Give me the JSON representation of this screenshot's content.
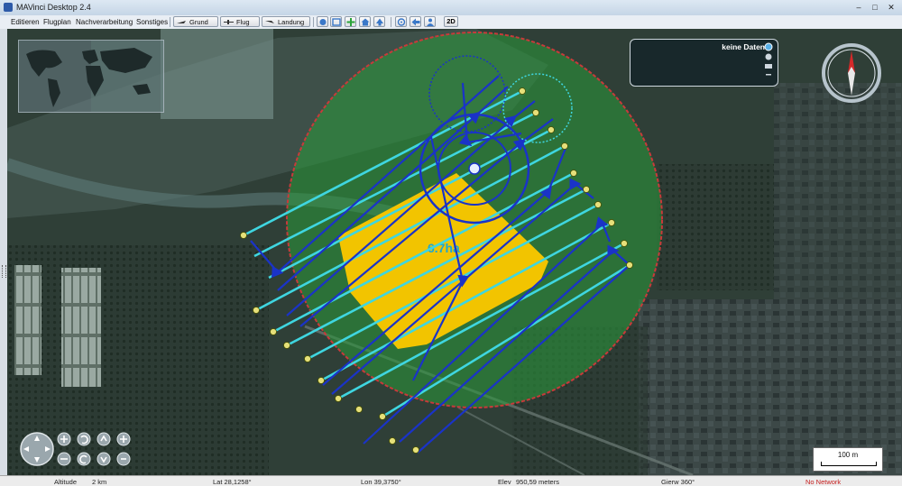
{
  "window": {
    "title": "MAVinci Desktop 2.4",
    "minimize": "–",
    "maximize": "□",
    "close": "✕"
  },
  "menu": {
    "items": [
      "Editieren",
      "Flugplan",
      "Nachverarbeitung",
      "Sonstiges"
    ]
  },
  "toolbar": {
    "buttons": [
      {
        "label": "Grund",
        "icon": "takeoff-icon"
      },
      {
        "label": "Flug",
        "icon": "plane-icon"
      },
      {
        "label": "Landung",
        "icon": "landing-icon"
      }
    ],
    "icons": [
      "select-icon",
      "measure-icon",
      "add-icon",
      "home-icon",
      "up-icon",
      "center-icon",
      "back-icon",
      "person-icon"
    ],
    "view_2d": "2D"
  },
  "overlay": {
    "legend_title": "keine Daten",
    "area_label": "6.7ha",
    "scale_label": "100 m"
  },
  "colors": {
    "flight_line": "#1a33c8",
    "image_line": "#3fd6e0",
    "area_fill": "#f2c400",
    "range_circle": "#2a9a3a",
    "range_border": "#c83a3a"
  },
  "navigation": {
    "icons": [
      "pan-icon",
      "zoom-in-icon",
      "zoom-out-icon",
      "rotate-left-icon",
      "rotate-right-icon",
      "tilt-up-icon",
      "tilt-down-icon",
      "reset-icon",
      "look-icon"
    ]
  },
  "status": {
    "altitude_label": "Altitude",
    "altitude_value": "2 km",
    "lat": "Lat 28,1258°",
    "lon": "Lon 39,3750°",
    "elev_label": "Elev",
    "elev_value": "950,59 meters",
    "heading": "Gierw 360°",
    "network": "No Network"
  }
}
